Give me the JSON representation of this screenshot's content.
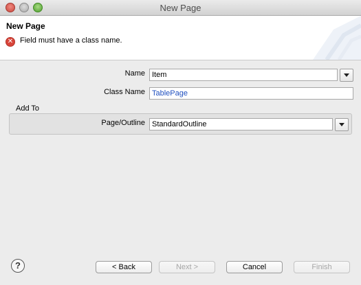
{
  "window": {
    "title": "New Page"
  },
  "header": {
    "title": "New Page",
    "error_message": "Field must have a class name."
  },
  "form": {
    "name_label": "Name",
    "name_value": "Item",
    "class_name_label": "Class Name",
    "class_name_value": "TablePage",
    "add_to_label": "Add To",
    "page_outline_label": "Page/Outline",
    "page_outline_value": "StandardOutline"
  },
  "footer": {
    "help_icon": "?",
    "back_label": "< Back",
    "next_label": "Next >",
    "cancel_label": "Cancel",
    "finish_label": "Finish"
  },
  "colors": {
    "class_name_text": "#1f4fbf",
    "error": "#d8453a"
  }
}
